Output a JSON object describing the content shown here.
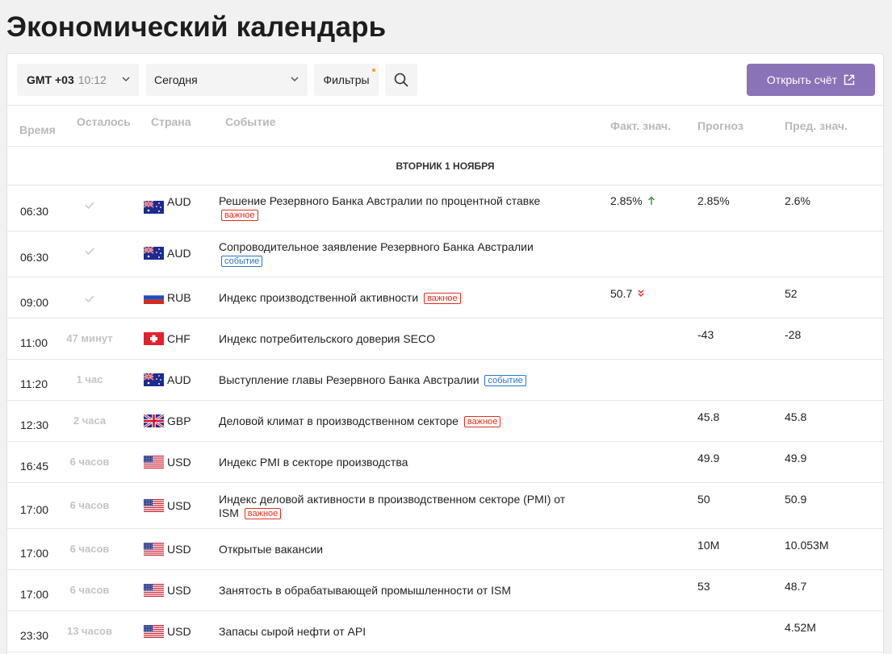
{
  "page_title": "Экономический календарь",
  "toolbar": {
    "timezone_label": "GMT +03",
    "timezone_time": "10:12",
    "day_select": "Сегодня",
    "filters_label": "Фильтры",
    "open_account_label": "Открыть счёт"
  },
  "columns": {
    "time": "Время",
    "remaining": "Осталось",
    "country": "Страна",
    "event": "Событие",
    "actual": "Факт. знач.",
    "forecast": "Прогноз",
    "previous": "Пред. знач."
  },
  "date_header": "ВТОРНИК 1 НОЯБРЯ",
  "badges": {
    "important": "важное",
    "event": "событие"
  },
  "rows": [
    {
      "time": "06:30",
      "remaining": "",
      "done": true,
      "flag": "au",
      "currency": "AUD",
      "event": "Решение Резервного Банка Австралии по процентной ставке",
      "badge": "important",
      "badge_text": "важное",
      "actual": "2.85%",
      "trend": "up",
      "forecast": "2.85%",
      "previous": "2.6%"
    },
    {
      "time": "06:30",
      "remaining": "",
      "done": true,
      "flag": "au",
      "currency": "AUD",
      "event": "Сопроводительное заявление Резервного Банка Австралии",
      "badge": "event",
      "badge_text": "событие",
      "actual": "",
      "trend": "",
      "forecast": "",
      "previous": ""
    },
    {
      "time": "09:00",
      "remaining": "",
      "done": true,
      "flag": "ru",
      "currency": "RUB",
      "event": "Индекс производственной активности",
      "badge": "important",
      "badge_text": "важное",
      "actual": "50.7",
      "trend": "down",
      "forecast": "",
      "previous": "52"
    },
    {
      "time": "11:00",
      "remaining": "47 минут",
      "done": false,
      "flag": "ch",
      "currency": "CHF",
      "event": "Индекс потребительского доверия SECO",
      "badge": "",
      "badge_text": "",
      "actual": "",
      "trend": "",
      "forecast": "-43",
      "previous": "-28"
    },
    {
      "time": "11:20",
      "remaining": "1 час",
      "done": false,
      "flag": "au",
      "currency": "AUD",
      "event": "Выступление главы Резервного Банка Австралии",
      "badge": "event",
      "badge_text": "событие",
      "actual": "",
      "trend": "",
      "forecast": "",
      "previous": ""
    },
    {
      "time": "12:30",
      "remaining": "2 часа",
      "done": false,
      "flag": "gb",
      "currency": "GBP",
      "event": "Деловой климат в производственном секторе",
      "badge": "important",
      "badge_text": "важное",
      "actual": "",
      "trend": "",
      "forecast": "45.8",
      "previous": "45.8"
    },
    {
      "time": "16:45",
      "remaining": "6 часов",
      "done": false,
      "flag": "us",
      "currency": "USD",
      "event": "Индекс PMI в секторе производства",
      "badge": "",
      "badge_text": "",
      "actual": "",
      "trend": "",
      "forecast": "49.9",
      "previous": "49.9"
    },
    {
      "time": "17:00",
      "remaining": "6 часов",
      "done": false,
      "flag": "us",
      "currency": "USD",
      "event": "Индекс деловой активности в производственном секторе (PMI) от ISM",
      "badge": "important",
      "badge_text": "важное",
      "actual": "",
      "trend": "",
      "forecast": "50",
      "previous": "50.9"
    },
    {
      "time": "17:00",
      "remaining": "6 часов",
      "done": false,
      "flag": "us",
      "currency": "USD",
      "event": "Открытые вакансии",
      "badge": "",
      "badge_text": "",
      "actual": "",
      "trend": "",
      "forecast": "10M",
      "previous": "10.053M"
    },
    {
      "time": "17:00",
      "remaining": "6 часов",
      "done": false,
      "flag": "us",
      "currency": "USD",
      "event": "Занятость в обрабатывающей промышленности от ISM",
      "badge": "",
      "badge_text": "",
      "actual": "",
      "trend": "",
      "forecast": "53",
      "previous": "48.7"
    },
    {
      "time": "23:30",
      "remaining": "13 часов",
      "done": false,
      "flag": "us",
      "currency": "USD",
      "event": "Запасы сырой нефти от API",
      "badge": "",
      "badge_text": "",
      "actual": "",
      "trend": "",
      "forecast": "",
      "previous": "4.52M"
    }
  ]
}
